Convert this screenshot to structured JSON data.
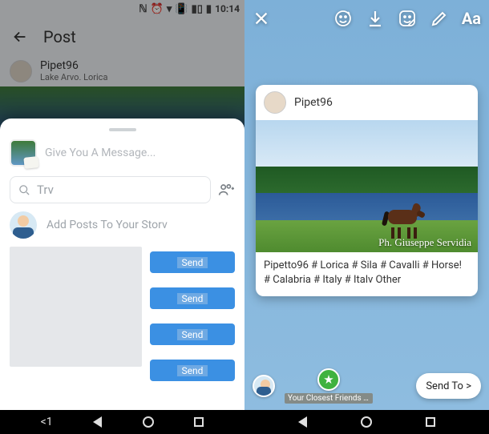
{
  "status": {
    "time": "10:14"
  },
  "left": {
    "header_title": "Post",
    "user": {
      "name": "Pipet96",
      "location": "Lake Arvo. Lorica"
    },
    "sheet": {
      "message_placeholder": "Give You A Message...",
      "search_placeholder": "Trv",
      "add_story_label": "Add Posts To Your Storv",
      "send_label": "Send"
    }
  },
  "right": {
    "card": {
      "user_name": "Pipet96",
      "signature": "Ph. Giuseppe Servidia",
      "caption": "Pipetto96 # Lorica # Sila # Cavalli # Horse! # Calabria # Italy # Italv Other"
    },
    "bottom": {
      "closest_friends": "Your Closest Friends Storv",
      "send_to": "Send To >"
    }
  },
  "nav": {
    "back_lt": "<1"
  }
}
